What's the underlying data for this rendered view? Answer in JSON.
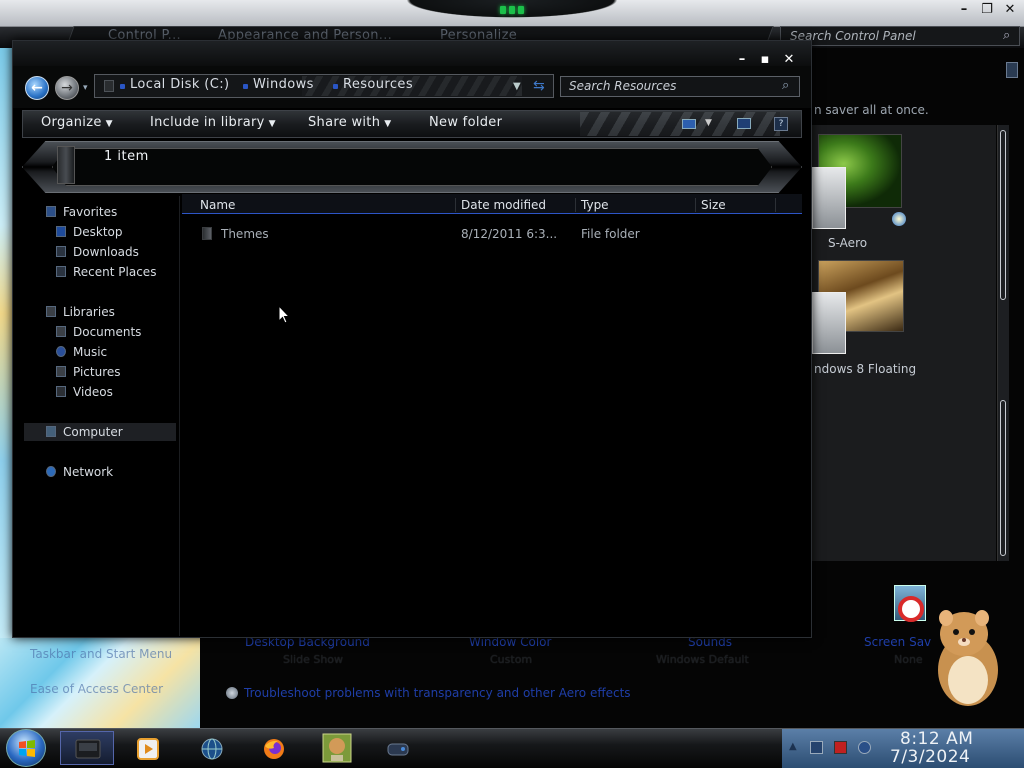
{
  "control_panel": {
    "breadcrumbs": [
      "Control P...",
      "Appearance and Person...",
      "Personalize"
    ],
    "search_placeholder": "Search Control Panel",
    "description_fragment": "n saver all at once.",
    "themes": [
      {
        "label": "S-Aero"
      },
      {
        "label": "ndows 8 Floating"
      }
    ],
    "bottom_links": [
      {
        "title": "Desktop Background",
        "subtitle": "Slide Show"
      },
      {
        "title": "Window Color",
        "subtitle": "Custom"
      },
      {
        "title": "Sounds",
        "subtitle": "Windows Default"
      },
      {
        "title": "Screen Sav",
        "subtitle": "None"
      }
    ],
    "left_links": [
      "Taskbar and Start Menu",
      "Ease of Access Center"
    ],
    "troubleshoot_link": "Troubleshoot problems with transparency and other Aero effects"
  },
  "explorer": {
    "breadcrumbs": [
      "Local Disk (C:)",
      "Windows",
      "Resources"
    ],
    "search_placeholder": "Search Resources",
    "toolbar": {
      "organize": "Organize",
      "include_in_library": "Include in library",
      "share_with": "Share with",
      "new_folder": "New folder"
    },
    "item_count": "1 item",
    "nav_pane": {
      "favorites": "Favorites",
      "desktop": "Desktop",
      "downloads": "Downloads",
      "recent_places": "Recent Places",
      "libraries": "Libraries",
      "documents": "Documents",
      "music": "Music",
      "pictures": "Pictures",
      "videos": "Videos",
      "computer": "Computer",
      "network": "Network"
    },
    "columns": {
      "name": "Name",
      "date_modified": "Date modified",
      "type": "Type",
      "size": "Size"
    },
    "files": [
      {
        "name": "Themes",
        "date_modified": "8/12/2011 6:3...",
        "type": "File folder",
        "size": ""
      }
    ]
  },
  "taskbar": {
    "clock_time": "8:12 AM",
    "clock_date": "7/3/2024",
    "pinned": [
      "explorer",
      "media-player",
      "globe",
      "firefox",
      "hamster-box",
      "gamepad"
    ]
  },
  "colors": {
    "accent_blue": "#2d55c7",
    "led_green": "#1bc04a",
    "link_blue": "#1f3ea8"
  }
}
